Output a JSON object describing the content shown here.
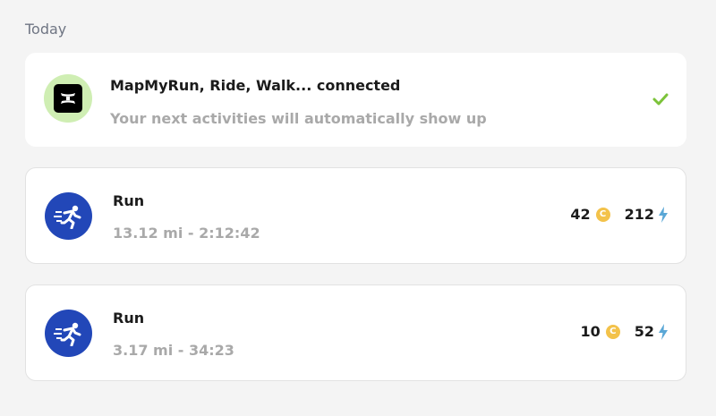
{
  "section": {
    "label": "Today"
  },
  "connection": {
    "title": "MapMyRun, Ride, Walk... connected",
    "subtitle": "Your next activities will automatically show up",
    "logo_icon": "under-armour-logo",
    "status_icon": "checkmark-icon",
    "colors": {
      "logo_bg": "#cfeeb3",
      "check": "#7cc33a"
    }
  },
  "activities": [
    {
      "title": "Run",
      "subtitle": "13.12 mi - 2:12:42",
      "coins": "42",
      "energy": "212",
      "icon": "runner-icon"
    },
    {
      "title": "Run",
      "subtitle": "3.17 mi - 34:23",
      "coins": "10",
      "energy": "52",
      "icon": "runner-icon"
    }
  ],
  "colors": {
    "activity_icon_bg": "#2247b8",
    "coin": "#f3c24a",
    "bolt": "#5aa7d6"
  }
}
